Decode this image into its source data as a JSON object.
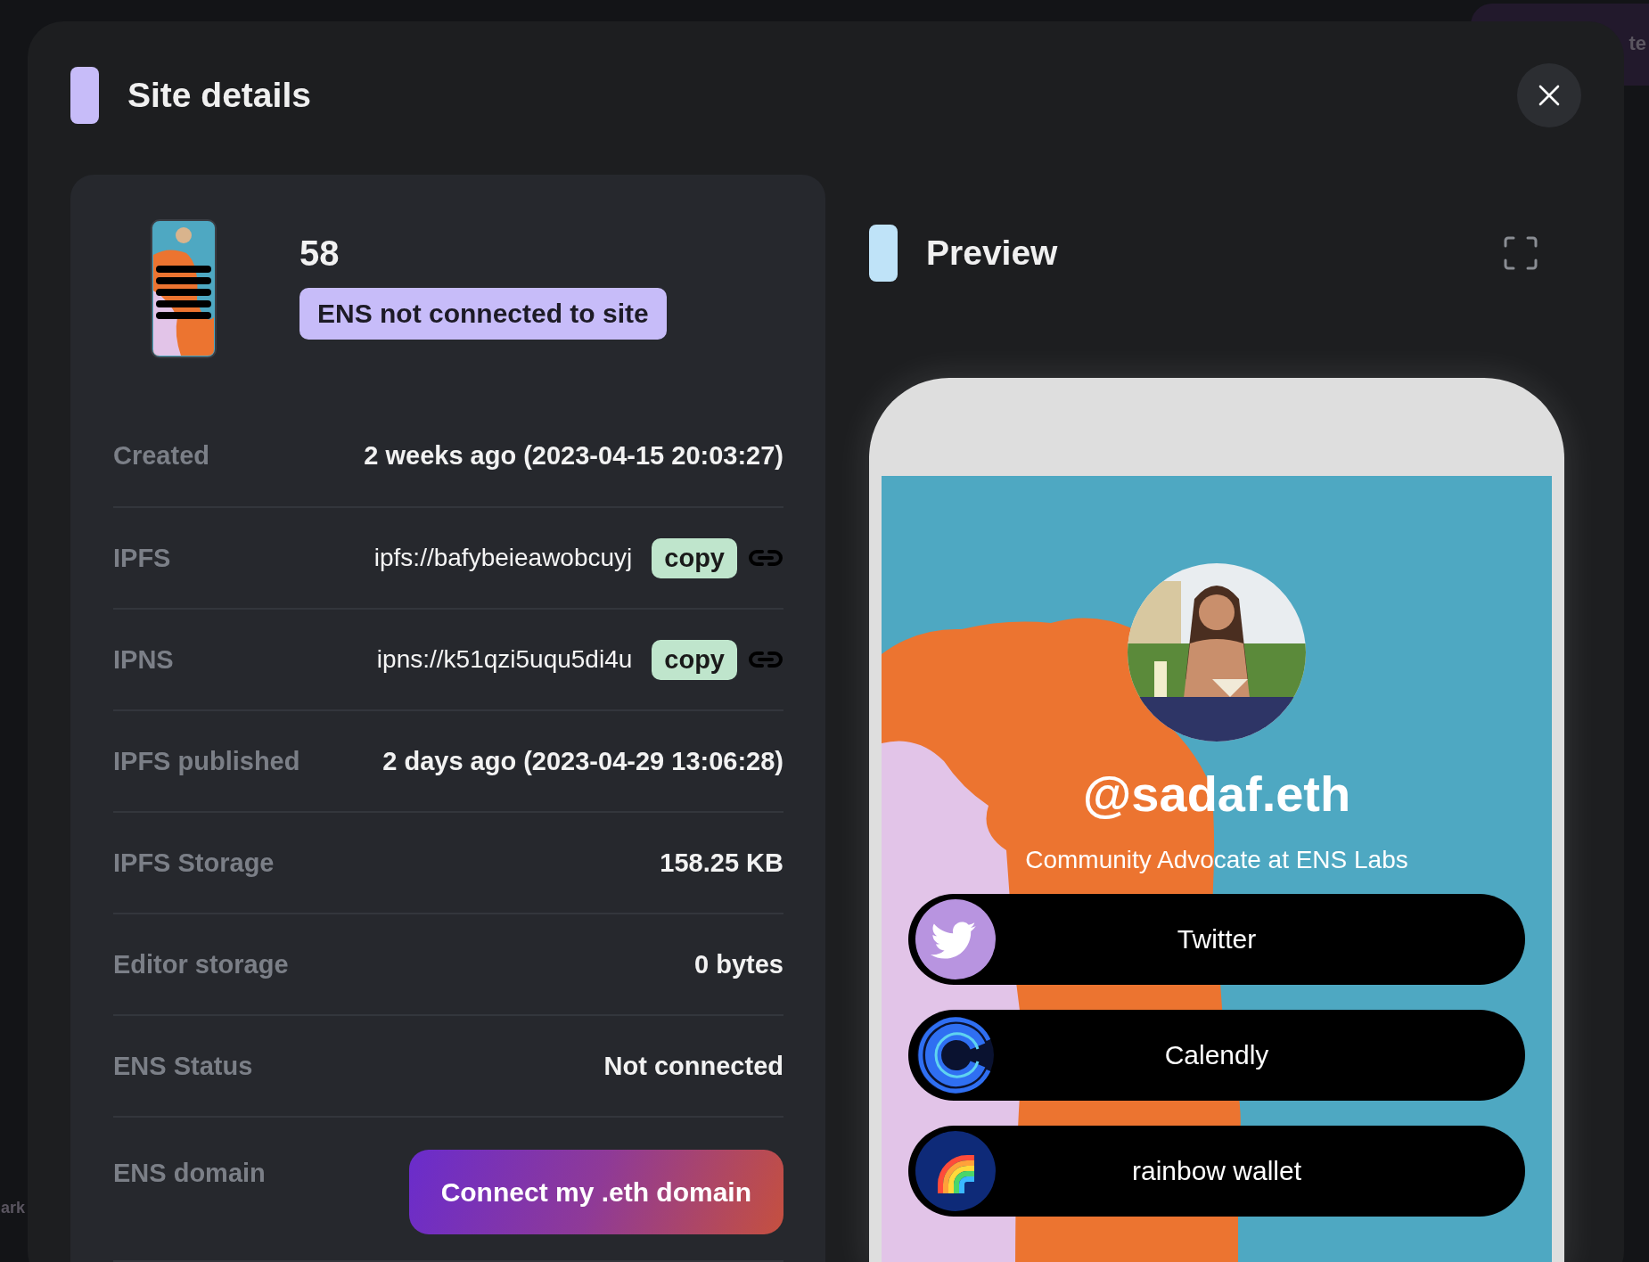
{
  "background_texts": [
    {
      "text": "te",
      "kind": "top-right"
    },
    {
      "text": "ark",
      "kind": "bottom-left"
    }
  ],
  "dialog": {
    "title": "Site details"
  },
  "site": {
    "name": "58",
    "badge": "ENS not connected to site"
  },
  "details": [
    {
      "kind": "text",
      "label": "Created",
      "value": "2 weeks ago (2023-04-15 20:03:27)"
    },
    {
      "kind": "address",
      "label": "IPFS",
      "value": "ipfs://bafybeieawobcuyj",
      "action": "copy"
    },
    {
      "kind": "address",
      "label": "IPNS",
      "value": "ipns://k51qzi5uqu5di4u",
      "action": "copy"
    },
    {
      "kind": "text",
      "label": "IPFS published",
      "value": "2 days ago (2023-04-29 13:06:28)"
    },
    {
      "kind": "text",
      "label": "IPFS Storage",
      "value": "158.25 KB"
    },
    {
      "kind": "text",
      "label": "Editor storage",
      "value": "0 bytes"
    },
    {
      "kind": "text",
      "label": "ENS Status",
      "value": "Not connected"
    },
    {
      "kind": "button",
      "label": "ENS domain",
      "value": "Connect my .eth domain"
    }
  ],
  "preview": {
    "title": "Preview",
    "profile": {
      "handle": "@sadaf.eth",
      "bio": "Community Advocate at ENS Labs"
    },
    "links": [
      {
        "label": "Twitter",
        "kind": "bird"
      },
      {
        "label": "Calendly",
        "kind": "letter-c"
      },
      {
        "label": "rainbow wallet",
        "kind": "rainbow"
      }
    ]
  }
}
